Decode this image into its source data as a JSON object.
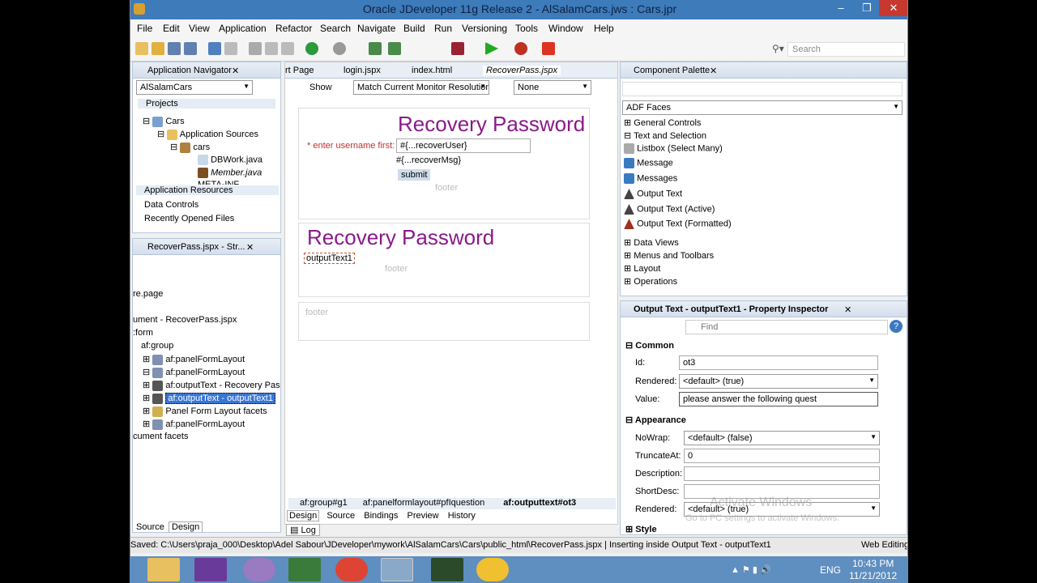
{
  "window": {
    "title": "Oracle JDeveloper 11g Release 2 - AlSalamCars.jws : Cars.jpr",
    "controls": [
      "–",
      "❐",
      "✕"
    ]
  },
  "menu": [
    "File",
    "Edit",
    "View",
    "Application",
    "Refactor",
    "Search",
    "Navigate",
    "Build",
    "Run",
    "Versioning",
    "Tools",
    "Window",
    "Help"
  ],
  "search": {
    "placeholder": "Search"
  },
  "navigator": {
    "tab_label": "Application Navigator",
    "app_select": "AlSalamCars",
    "projects_label": "Projects",
    "tree": [
      "Cars",
      "Application Sources",
      "cars",
      "DBWork.java",
      "Member.java",
      "META-INF"
    ],
    "sections": [
      "Application Resources",
      "Data Controls",
      "Recently Opened Files"
    ]
  },
  "structure": {
    "tab_label": "RecoverPass.jspx - Str...",
    "items": [
      "re.page",
      "ument - RecoverPass.jspx",
      ":form",
      "af:group",
      "af:panelFormLayout",
      "af:panelFormLayout",
      "af:outputText - Recovery Pass",
      "af:outputText - outputText1",
      "Panel Form Layout facets",
      "af:panelFormLayout",
      "cument facets"
    ],
    "bottom_tabs": [
      "Source",
      "Design"
    ]
  },
  "editor": {
    "tabs": [
      "rt Page",
      "login.jspx",
      "index.html",
      "RecoverPass.jspx"
    ],
    "show_label": "Show",
    "resolution": "Match Current Monitor Resolution",
    "style_select": "None",
    "heading1": "Recovery Password",
    "username_label": "* enter username first:",
    "username_value": "#{...recoverUser}",
    "recover_msg": "#{...recoverMsg}",
    "submit": "submit",
    "footer1": "footer",
    "heading2": "Recovery Password",
    "output_text": "outputText1",
    "footer2": "footer",
    "footer3": "footer",
    "breadcrumb": [
      "af:group#g1",
      "af:panelformlayout#pfIquestion",
      "af:outputtext#ot3"
    ],
    "bottom_tabs": [
      "Design",
      "Source",
      "Bindings",
      "Preview",
      "History"
    ],
    "log_tab": "Log"
  },
  "palette": {
    "tab_label": "Component Palette",
    "library": "ADF Faces",
    "categories_top": [
      "General Controls",
      "Text and Selection"
    ],
    "items": [
      "Listbox (Select Many)",
      "Message",
      "Messages",
      "Output Text",
      "Output Text (Active)",
      "Output Text (Formatted)"
    ],
    "categories_bottom": [
      "Data Views",
      "Menus and Toolbars",
      "Layout",
      "Operations"
    ]
  },
  "inspector": {
    "tab_label": "Output Text - outputText1 - Property Inspector",
    "find_placeholder": "Find",
    "common": "Common",
    "fields": [
      {
        "label": "Id:",
        "value": "ot3"
      },
      {
        "label": "Rendered:",
        "value": "<default> (true)"
      },
      {
        "label": "Value:",
        "value": "please answer the following quest"
      }
    ],
    "appearance": "Appearance",
    "appearance_fields": [
      {
        "label": "NoWrap:",
        "value": "<default> (false)"
      },
      {
        "label": "TruncateAt:",
        "value": "0"
      },
      {
        "label": "Description:",
        "value": ""
      },
      {
        "label": "ShortDesc:",
        "value": ""
      },
      {
        "label": "Rendered:",
        "value": "<default> (true)"
      }
    ],
    "style": "Style",
    "watermark1": "Activate Windows",
    "watermark2": "Go to PC settings to activate Windows."
  },
  "status": {
    "left": "Saved: C:\\Users\\praja_000\\Desktop\\Adel Sabour\\JDeveloper\\mywork\\AlSalamCars\\Cars\\public_html\\RecoverPass.jspx | Inserting inside Output Text - outputText1",
    "right": "Web Editing"
  },
  "taskbar": {
    "lang": "ENG",
    "time": "10:43 PM",
    "date": "11/21/2012"
  }
}
